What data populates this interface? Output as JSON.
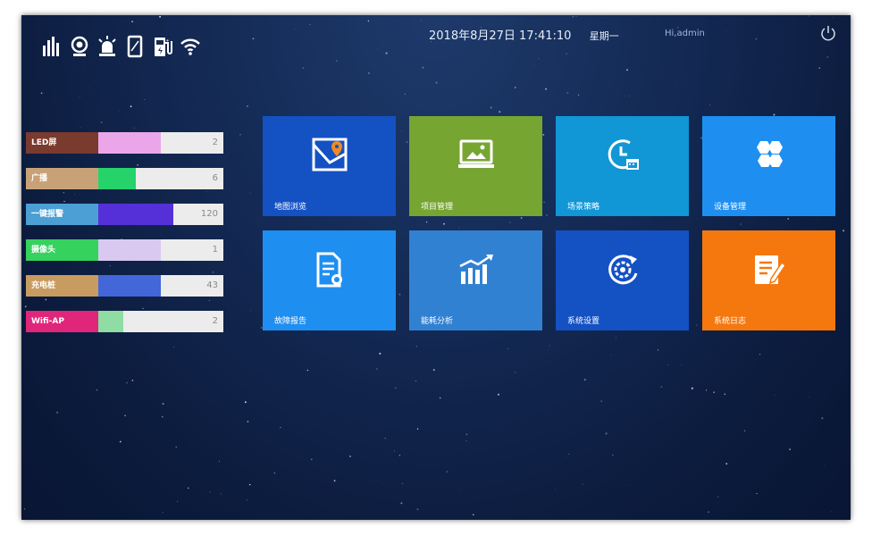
{
  "header": {
    "datetime": "2018年8月27日 17:41:10",
    "weekday": "星期一",
    "greeting": "Hi,admin"
  },
  "top_icons": [
    "signal-bars-icon",
    "camera-icon",
    "alarm-light-icon",
    "phone-icon",
    "charger-icon",
    "wifi-icon"
  ],
  "stats": [
    {
      "label": "LED屏",
      "value": "2",
      "label_color": "#7a3a2e",
      "bar_color": "#eba6ea",
      "fill": 0.5
    },
    {
      "label": "广播",
      "value": "6",
      "label_color": "#c8a276",
      "bar_color": "#26d36b",
      "fill": 0.3
    },
    {
      "label": "一键报警",
      "value": "120",
      "label_color": "#4b9fd4",
      "bar_color": "#5530d8",
      "fill": 0.6
    },
    {
      "label": "摄像头",
      "value": "1",
      "label_color": "#35d25d",
      "bar_color": "#d9c9f1",
      "fill": 0.5
    },
    {
      "label": "充电桩",
      "value": "43",
      "label_color": "#c89c60",
      "bar_color": "#4367d8",
      "fill": 0.5
    },
    {
      "label": "Wifi-AP",
      "value": "2",
      "label_color": "#e0267a",
      "bar_color": "#8fdda3",
      "fill": 0.2
    }
  ],
  "tiles": [
    {
      "label": "地图浏览",
      "color": "#1451c3",
      "icon": "map-icon"
    },
    {
      "label": "项目管理",
      "color": "#76a532",
      "icon": "monitor-image-icon"
    },
    {
      "label": "场景策略",
      "color": "#1196d6",
      "icon": "clock-calendar-icon"
    },
    {
      "label": "设备管理",
      "color": "#1e8ff0",
      "icon": "hexagons-icon"
    },
    {
      "label": "故障报告",
      "color": "#1e8ff0",
      "icon": "document-search-icon"
    },
    {
      "label": "能耗分析",
      "color": "#3181d3",
      "icon": "bar-chart-icon"
    },
    {
      "label": "系统设置",
      "color": "#1451c3",
      "icon": "gear-refresh-icon"
    },
    {
      "label": "系统日志",
      "color": "#f5780f",
      "icon": "log-edit-icon"
    }
  ]
}
